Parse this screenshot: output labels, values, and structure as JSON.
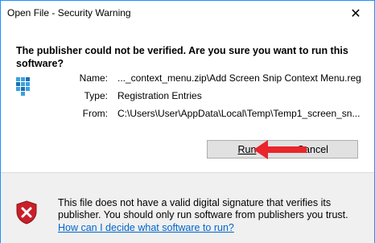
{
  "window": {
    "title": "Open File - Security Warning",
    "close_glyph": "✕"
  },
  "question": "The publisher could not be verified.  Are you sure you want to run this software?",
  "file": {
    "icon": "registry-file-icon",
    "fields": [
      {
        "label": "Name:",
        "value": "..._context_menu.zip\\Add Screen Snip Context Menu.reg"
      },
      {
        "label": "Type:",
        "value": "Registration Entries"
      },
      {
        "label": "From:",
        "value": "C:\\Users\\User\\AppData\\Local\\Temp\\Temp1_screen_sn..."
      }
    ]
  },
  "buttons": {
    "run": "Run",
    "cancel": "Cancel"
  },
  "annotation": {
    "arrow_color": "#e8262b",
    "icon": "red-arrow-icon"
  },
  "footer": {
    "icon": "shield-error-icon",
    "text": "This file does not have a valid digital signature that verifies its publisher.  You should only run software from publishers you trust.",
    "link": "How can I decide what software to run?"
  },
  "colors": {
    "window_border": "#1e90ff",
    "link": "#0066cc",
    "footer_bg": "#f0f0f0"
  }
}
